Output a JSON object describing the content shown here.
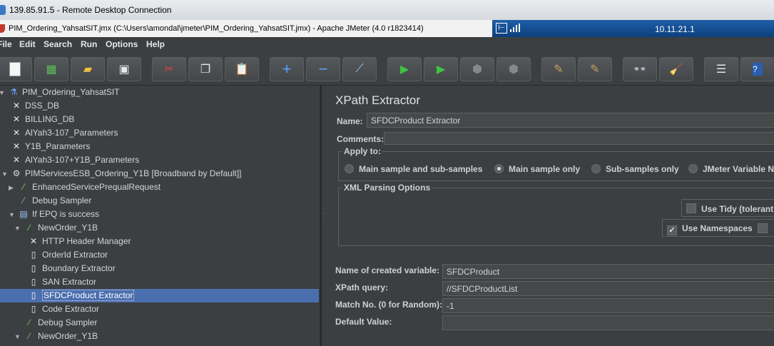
{
  "remote_desktop": {
    "title": "139.85.91.5 - Remote Desktop Connection",
    "connection_ip": "10.11.21.1"
  },
  "app": {
    "window_title": "PIM_Ordering_YahsatSIT.jmx (C:\\Users\\amondal\\jmeter\\PIM_Ordering_YahsatSIT.jmx) - Apache JMeter (4.0 r1823414)"
  },
  "menu": [
    "File",
    "Edit",
    "Search",
    "Run",
    "Options",
    "Help"
  ],
  "toolbar_icons": [
    "new-icon",
    "templates-icon",
    "open-icon",
    "save-icon",
    "cut-icon",
    "copy-icon",
    "paste-icon",
    "expand-icon",
    "collapse-icon",
    "toggle-icon",
    "start-icon",
    "start-no-pause-icon",
    "stop-icon",
    "shutdown-icon",
    "clear-icon",
    "clear-all-icon",
    "search-icon",
    "reset-search-icon",
    "function-helper-icon",
    "help-icon"
  ],
  "tree": [
    {
      "label": "PIM_Ordering_YahsatSIT",
      "icon": "test-plan-icon"
    },
    {
      "label": "DSS_DB",
      "icon": "config-element-icon"
    },
    {
      "label": "BILLING_DB",
      "icon": "config-element-icon"
    },
    {
      "label": "AlYah3-107_Parameters",
      "icon": "config-element-icon"
    },
    {
      "label": "Y1B_Parameters",
      "icon": "config-element-icon"
    },
    {
      "label": "AlYah3-107+Y1B_Parameters",
      "icon": "config-element-icon"
    },
    {
      "label": "PIMServicesESB_Ordering_Y1B [Broadband by Default]]",
      "icon": "thread-group-icon"
    },
    {
      "label": "EnhancedServicePrequalRequest",
      "icon": "sampler-icon"
    },
    {
      "label": "Debug Sampler",
      "icon": "sampler-icon"
    },
    {
      "label": "If EPQ is success",
      "icon": "controller-icon"
    },
    {
      "label": "NewOrder_Y1B",
      "icon": "sampler-icon"
    },
    {
      "label": "HTTP Header Manager",
      "icon": "config-element-icon"
    },
    {
      "label": "OrderId Extractor",
      "icon": "post-processor-icon"
    },
    {
      "label": "Boundary Extractor",
      "icon": "post-processor-icon"
    },
    {
      "label": "SAN Extractor",
      "icon": "post-processor-icon"
    },
    {
      "label": "SFDCProduct Extractor",
      "icon": "post-processor-icon"
    },
    {
      "label": "Code Extractor",
      "icon": "post-processor-icon"
    },
    {
      "label": "Debug Sampler",
      "icon": "sampler-icon"
    },
    {
      "label": "NewOrder_Y1B",
      "icon": "sampler-icon"
    }
  ],
  "panel": {
    "title": "XPath Extractor",
    "name_label": "Name:",
    "name_value": "SFDCProduct Extractor",
    "comments_label": "Comments:",
    "apply_to": {
      "label": "Apply to:",
      "options": [
        "Main sample and sub-samples",
        "Main sample only",
        "Sub-samples only",
        "JMeter Variable N"
      ],
      "selected": "Main sample only"
    },
    "xml_options": {
      "label": "XML Parsing Options",
      "use_tidy": "Use Tidy (tolerant",
      "use_namespaces": "Use Namespaces"
    },
    "var_label": "Name of created variable:",
    "var_value": "SFDCProduct",
    "xpath_label": "XPath query:",
    "xpath_value": "//SFDCProductList",
    "match_label": "Match No. (0 for Random):",
    "match_value": "-1",
    "default_label": "Default Value:",
    "default_value": ""
  }
}
